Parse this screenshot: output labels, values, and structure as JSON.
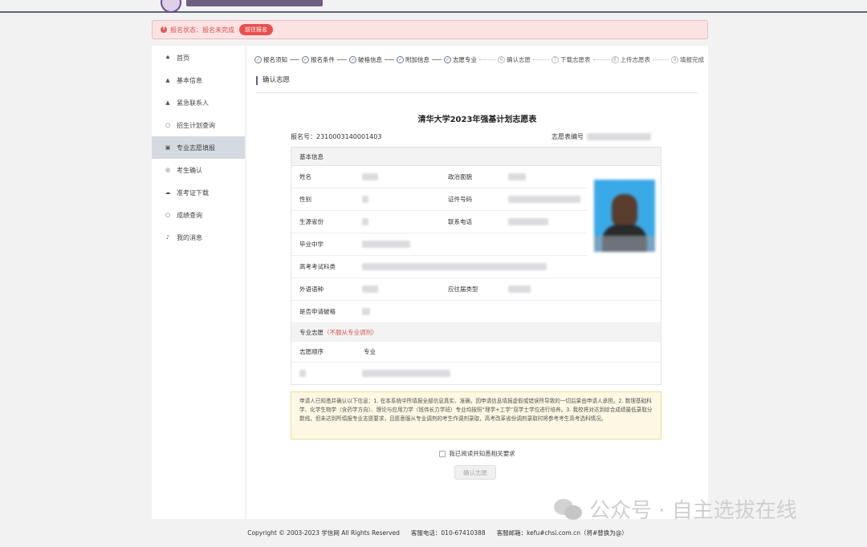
{
  "status": {
    "text": "报名状态：报名未完成",
    "action": "前往报名"
  },
  "sidebar": {
    "items": [
      {
        "label": "首页",
        "icon": "home-icon",
        "glyph": "♠"
      },
      {
        "label": "基本信息",
        "icon": "user-icon",
        "glyph": "▲"
      },
      {
        "label": "紧急联系人",
        "icon": "user-icon",
        "glyph": "▲"
      },
      {
        "label": "招生计划查询",
        "icon": "search-icon",
        "glyph": "○"
      },
      {
        "label": "专业志愿填报",
        "icon": "form-icon",
        "glyph": "▣",
        "active": true
      },
      {
        "label": "考生确认",
        "icon": "check-icon",
        "glyph": "◎"
      },
      {
        "label": "准考证下载",
        "icon": "download-icon",
        "glyph": "☁"
      },
      {
        "label": "成绩查询",
        "icon": "search-icon",
        "glyph": "○"
      },
      {
        "label": "我的消息",
        "icon": "bell-icon",
        "glyph": "♪"
      }
    ]
  },
  "steps": [
    {
      "label": "报名须知",
      "done": true
    },
    {
      "label": "报名条件",
      "done": true
    },
    {
      "label": "破格信息",
      "done": true
    },
    {
      "label": "附加信息",
      "done": true
    },
    {
      "label": "志愿专业",
      "done": true
    },
    {
      "label": "确认志愿",
      "num": "6",
      "done": false
    },
    {
      "label": "下载志愿表",
      "num": "7",
      "done": false
    },
    {
      "label": "上传志愿表",
      "num": "8",
      "done": false
    },
    {
      "label": "填报完成",
      "num": "9",
      "done": false
    }
  ],
  "section": {
    "title": "确认志愿"
  },
  "form": {
    "title": "清华大学2023年强基计划志愿表",
    "reg_no": "报名号：2310003140001403",
    "form_no_label": "志愿表编号",
    "basic_info": "基本信息",
    "labels": {
      "name": "姓名",
      "political": "政治面貌",
      "gender": "性别",
      "id_no": "证件号码",
      "province": "生源省份",
      "phone": "联系电话",
      "school": "毕业中学",
      "subjects": "高考考试科类",
      "language": "外语语种",
      "grad_type": "应往届类型",
      "exception": "是否申请破格"
    },
    "major_title": "专业志愿",
    "major_note": "（不服从专业调剂）",
    "major_order": "志愿顺序",
    "major_col": "专业"
  },
  "notice": "申请人已知悉并确认以下信息：1. 在本系统中所填报全部信息真实、准确，因申请信息填报虚假或错误所导致的一切后果由申请人承担。2. 数理基础科学、化学生物学（含药学方向）、理论与应用力学（钱伟长力学班）专业均按照“理学+工学”双学士学位进行培养。3. 我校将对达到综合成绩最低录取分数线，但未达到所填报专业志愿要求，且愿意服从专业调剂的考生作调剂录取，高考改革省份调剂录取时将参考考生高考选科情况。",
  "agree_label": "我已阅读并知悉相关要求",
  "confirm_button": "确认志愿",
  "footer": {
    "copyright": "Copyright © 2003-2023 学信网 All Rights Reserved",
    "phone": "客服电话：010-67410388",
    "email": "客服邮箱：kefu#chsi.com.cn（将#替换为@）"
  },
  "watermark": "公众号 · 自主选拔在线"
}
